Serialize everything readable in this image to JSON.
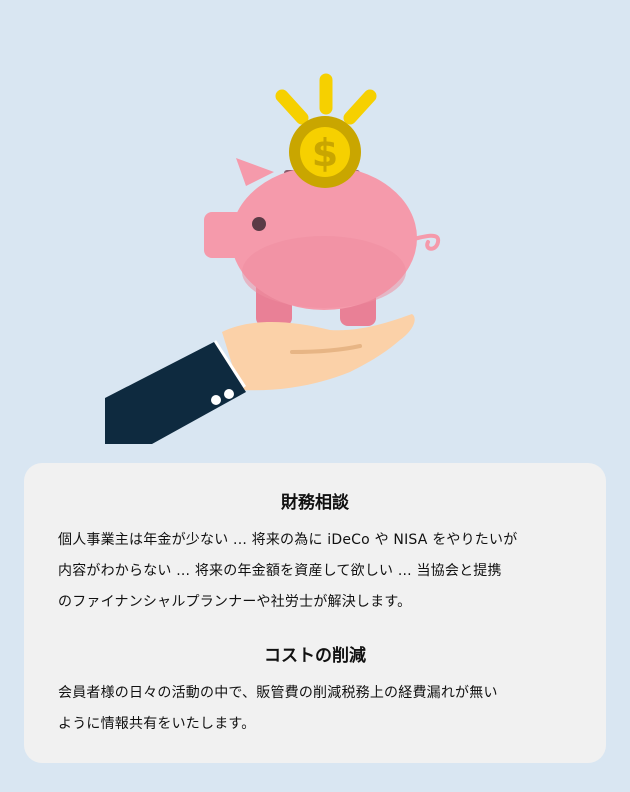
{
  "illustration": {
    "subject": "piggy-bank-with-coin-on-hand",
    "colors": {
      "background": "#d9e6f2",
      "pig": "#f59aab",
      "pig_shadow": "#e98096",
      "coin": "#c9a600",
      "coin_inner": "#f6d000",
      "rays": "#f6d000",
      "sleeve": "#0e2a3f",
      "skin": "#fbd1a8"
    },
    "coin_symbol": "$"
  },
  "sections": [
    {
      "title": "財務相談",
      "lines": [
        "個人事業主は年金が少ない ... 将来の為に iDeCo や NISA をやりたいが",
        "内容がわからない ... 将来の年金額を資産して欲しい ... 当協会と提携",
        "のファイナンシャルプランナーや社労士が解決します。"
      ]
    },
    {
      "title": "コストの削減",
      "lines": [
        "会員者様の日々の活動の中で、販管費の削減税務上の経費漏れが無い",
        "ように情報共有をいたします。"
      ]
    }
  ]
}
